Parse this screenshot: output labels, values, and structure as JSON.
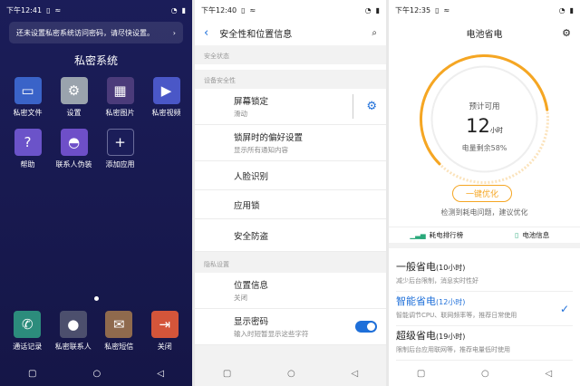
{
  "phone1": {
    "time": "下午12:41",
    "notice": "还未设置私密系统访问密码，请尽快设置。",
    "title": "私密系统",
    "apps": [
      {
        "label": "私密文件",
        "icon": "folder-icon",
        "bg": "#3a63c8"
      },
      {
        "label": "设置",
        "icon": "gear-icon",
        "bg": "#9aa3ad"
      },
      {
        "label": "私密图片",
        "icon": "gallery-icon",
        "bg": "#4b3b7a"
      },
      {
        "label": "私密视频",
        "icon": "play-icon",
        "bg": "#4a57c7"
      },
      {
        "label": "帮助",
        "icon": "help-icon",
        "bg": "#6b53c9"
      },
      {
        "label": "联系人伪装",
        "icon": "disguise-icon",
        "bg": "#6e4fc8"
      },
      {
        "label": "添加应用",
        "icon": "plus-icon",
        "bg": "#1b1d59"
      }
    ],
    "dock": [
      {
        "label": "通话记录",
        "icon": "phone-icon",
        "bg": "#2c8c7c"
      },
      {
        "label": "私密联系人",
        "icon": "ninja-icon",
        "bg": "#4c4f6d"
      },
      {
        "label": "私密短信",
        "icon": "message-icon",
        "bg": "#8f6a4d"
      },
      {
        "label": "关闭",
        "icon": "exit-icon",
        "bg": "#d4553a"
      }
    ]
  },
  "phone2": {
    "time": "下午12:40",
    "title": "安全性和位置信息",
    "sections": {
      "security_status": "安全状态",
      "device_security": "设备安全性",
      "privacy": "隐私设置"
    },
    "items": {
      "screen_lock": {
        "main": "屏幕锁定",
        "sub": "滑动"
      },
      "lock_pref": {
        "main": "锁屏时的偏好设置",
        "sub": "显示所有通知内容"
      },
      "face": {
        "main": "人脸识别"
      },
      "app_lock": {
        "main": "应用锁"
      },
      "security": {
        "main": "安全防盗"
      },
      "location": {
        "main": "位置信息",
        "sub": "关闭"
      },
      "show_pw": {
        "main": "显示密码",
        "sub": "输入时短暂显示这些字符"
      }
    },
    "show_password_on": true
  },
  "phone3": {
    "time": "下午12:35",
    "title": "电池省电",
    "estimate_label": "预计可用",
    "hours": "12",
    "hours_unit": "小时",
    "remaining": "电量剩余58%",
    "remaining_fraction": 0.58,
    "optimize_btn": "一键优化",
    "hint": "检测到耗电问题，建议优化",
    "tabs": {
      "rank": "耗电排行榜",
      "info": "电池信息"
    },
    "modes": [
      {
        "title": "一般省电",
        "hours": "(10小时)",
        "desc": "减少后台限制，消息实时性好",
        "selected": false
      },
      {
        "title": "智能省电",
        "hours": "(12小时)",
        "desc": "智能调节CPU、联网频率等，推荐日常使用",
        "selected": true
      },
      {
        "title": "超级省电",
        "hours": "(19小时)",
        "desc": "限制后台应用联网等，推荐电量低时使用",
        "selected": false
      }
    ],
    "accent": "#1e6fd9",
    "gauge_color": "#f5a623"
  }
}
